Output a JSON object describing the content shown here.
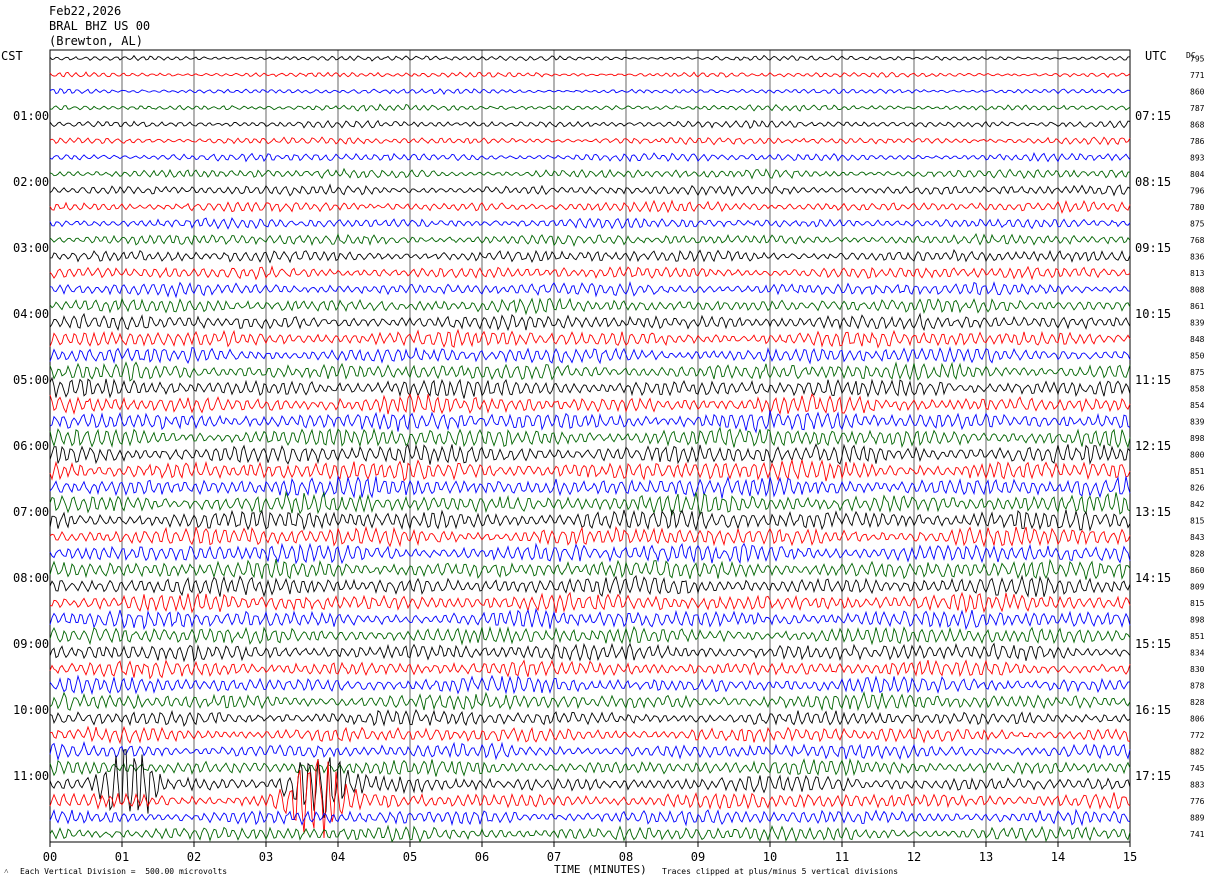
{
  "header": {
    "date": "Feb22,2026",
    "station": "BRAL BHZ US 00",
    "location": "(Brewton, AL)"
  },
  "left_tz": "CST",
  "right_tz": "UTC",
  "dc_label": "DC",
  "footer": {
    "vertical_division": "Each Vertical Division =  500.00 microvolts",
    "xlabel": "TIME (MINUTES)",
    "clip_note": "Traces clipped at plus/minus 5 vertical divisions"
  },
  "colors": {
    "trace_cycle": [
      "#000000",
      "#ff0000",
      "#0000ff",
      "#006400"
    ],
    "grid": "#000000"
  },
  "chart_data": {
    "type": "helicorder",
    "title": "BRAL BHZ US 00",
    "xlabel": "TIME (MINUTES)",
    "xlim": [
      0,
      15
    ],
    "x_ticks": [
      "00",
      "01",
      "02",
      "03",
      "04",
      "05",
      "06",
      "07",
      "08",
      "09",
      "10",
      "11",
      "12",
      "13",
      "14",
      "15"
    ],
    "rows_per_hour": 4,
    "left_hour_labels": [
      "01:00",
      "02:00",
      "03:00",
      "04:00",
      "05:00",
      "06:00",
      "07:00",
      "08:00",
      "09:00",
      "10:00",
      "11:00"
    ],
    "right_hour_labels": [
      "07:15",
      "08:15",
      "09:15",
      "10:15",
      "11:15",
      "12:15",
      "13:15",
      "14:15",
      "15:15",
      "16:15",
      "17:15"
    ],
    "dc_offsets": [
      795,
      771,
      860,
      787,
      868,
      786,
      893,
      804,
      796,
      780,
      875,
      768,
      836,
      813,
      808,
      861,
      839,
      848,
      850,
      875,
      858,
      854,
      839,
      898,
      800,
      851,
      826,
      842,
      815,
      843,
      828,
      860,
      809,
      815,
      898,
      851,
      834,
      830,
      878,
      828,
      806,
      772,
      882,
      745,
      883,
      776,
      889,
      741
    ],
    "relative_amplitude": [
      0.5,
      0.5,
      0.5,
      0.6,
      0.7,
      0.7,
      0.8,
      0.9,
      1.0,
      1.0,
      1.0,
      1.1,
      1.2,
      1.2,
      1.3,
      1.4,
      1.5,
      1.6,
      1.6,
      1.7,
      1.8,
      1.8,
      1.9,
      1.9,
      2.0,
      2.0,
      2.0,
      2.0,
      2.0,
      1.9,
      1.9,
      1.9,
      1.9,
      1.8,
      1.8,
      1.7,
      1.7,
      1.6,
      1.6,
      1.6,
      1.5,
      1.5,
      1.5,
      1.5,
      1.6,
      1.6,
      1.5,
      1.5
    ],
    "events": [
      {
        "row": 44,
        "minute": 1.1,
        "note": "burst"
      },
      {
        "row": 44,
        "minute": 3.7,
        "note": "burst, clipped"
      },
      {
        "row": 45,
        "minute": 3.7,
        "note": "burst, clipped"
      }
    ]
  }
}
